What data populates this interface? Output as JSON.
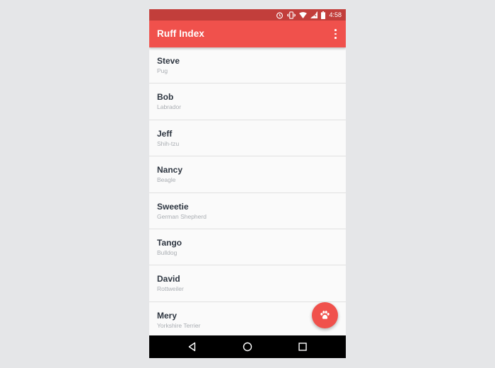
{
  "status_bar": {
    "time": "4:58",
    "icons": [
      "alarm-icon",
      "vibrate-icon",
      "wifi-icon",
      "no-signal-icon",
      "battery-icon"
    ],
    "background": "#c23e3b"
  },
  "app_bar": {
    "title": "Ruff Index",
    "background": "#f0514c",
    "overflow_icon": "more-vert-icon"
  },
  "dogs": [
    {
      "name": "Steve",
      "breed": "Pug"
    },
    {
      "name": "Bob",
      "breed": "Labrador"
    },
    {
      "name": "Jeff",
      "breed": "Shih-tzu"
    },
    {
      "name": "Nancy",
      "breed": "Beagle"
    },
    {
      "name": "Sweetie",
      "breed": "German Shepherd"
    },
    {
      "name": "Tango",
      "breed": "Bulldog"
    },
    {
      "name": "David",
      "breed": "Rottweiler"
    },
    {
      "name": "Mery",
      "breed": "Yorkshire Terrier"
    }
  ],
  "fab": {
    "icon": "paw-icon",
    "color": "#f0514c"
  },
  "navigation": {
    "buttons": [
      "back-icon",
      "home-icon",
      "recents-icon"
    ]
  }
}
